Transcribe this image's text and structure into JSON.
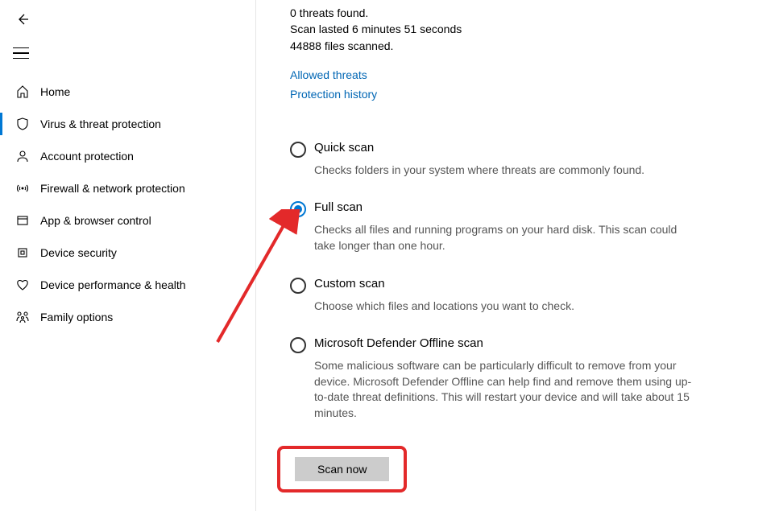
{
  "sidebar": {
    "items": [
      {
        "label": "Home"
      },
      {
        "label": "Virus & threat protection"
      },
      {
        "label": "Account protection"
      },
      {
        "label": "Firewall & network protection"
      },
      {
        "label": "App & browser control"
      },
      {
        "label": "Device security"
      },
      {
        "label": "Device performance & health"
      },
      {
        "label": "Family options"
      }
    ]
  },
  "scan_result": {
    "line1": "0 threats found.",
    "line2": "Scan lasted 6 minutes 51 seconds",
    "line3": "44888 files scanned."
  },
  "links": {
    "allowed": "Allowed threats",
    "history": "Protection history"
  },
  "options": {
    "quick": {
      "title": "Quick scan",
      "desc": "Checks folders in your system where threats are commonly found."
    },
    "full": {
      "title": "Full scan",
      "desc": "Checks all files and running programs on your hard disk. This scan could take longer than one hour."
    },
    "custom": {
      "title": "Custom scan",
      "desc": "Choose which files and locations you want to check."
    },
    "offline": {
      "title": "Microsoft Defender Offline scan",
      "desc": "Some malicious software can be particularly difficult to remove from your device. Microsoft Defender Offline can help find and remove them using up-to-date threat definitions. This will restart your device and will take about 15 minutes."
    }
  },
  "scan_button": "Scan now"
}
